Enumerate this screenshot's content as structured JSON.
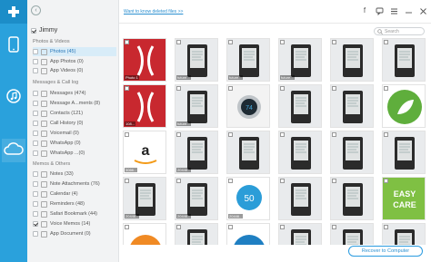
{
  "toolbar": {
    "link_text": "Want to know deleted files >>"
  },
  "search": {
    "placeholder": "Search"
  },
  "sidebar": {
    "user": "Jimmy",
    "sections": [
      {
        "title": "Photos & Videos",
        "items": [
          "Photos (45)",
          "App Photos (0)",
          "App Videos (0)"
        ]
      },
      {
        "title": "Messages & Call log",
        "items": [
          "Messages (474)",
          "Message A...ments (8)",
          "Contacts (121)",
          "Call History (0)",
          "Voicemail (0)",
          "WhatsApp (0)",
          "WhatsApp ...(0)"
        ]
      },
      {
        "title": "Memos & Others",
        "items": [
          "Notes (33)",
          "Note Attachments (76)",
          "Calendar (4)",
          "Reminders (48)",
          "Safari Bookmark (44)",
          "Voice Memos (14)",
          "App Document (0)"
        ]
      }
    ]
  },
  "grid": {
    "tiles": [
      {
        "label": "Photo 1",
        "icon": "red-tile-photo"
      },
      {
        "label": "future...",
        "icon": "ereader-photo"
      },
      {
        "label": "future...",
        "icon": "ereader-photo"
      },
      {
        "label": "future...",
        "icon": "ereader-photo"
      },
      {
        "label": "",
        "icon": "ereader-photo"
      },
      {
        "label": "",
        "icon": "ereader-photo"
      },
      {
        "label": "108...",
        "icon": "red-tile-photo"
      },
      {
        "label": "future...",
        "icon": "ereader-photo"
      },
      {
        "label": "",
        "icon": "thermostat-photo"
      },
      {
        "label": "",
        "icon": "ereader-photo"
      },
      {
        "label": "",
        "icon": "ereader-photo"
      },
      {
        "label": "",
        "icon": "green-leaf-photo"
      },
      {
        "label": "3066...",
        "icon": "amazon-logo"
      },
      {
        "label": "20446...",
        "icon": "ereader-photo"
      },
      {
        "label": "",
        "icon": "ereader-photo"
      },
      {
        "label": "",
        "icon": "ereader-photo"
      },
      {
        "label": "",
        "icon": "ereader-photo"
      },
      {
        "label": "",
        "icon": "ereader-photo"
      },
      {
        "label": "20446...",
        "icon": "ereader-photo"
      },
      {
        "label": "20446...",
        "icon": "ereader-photo"
      },
      {
        "label": "20446...",
        "icon": "blue-50-photo"
      },
      {
        "label": "",
        "icon": "ereader-photo"
      },
      {
        "label": "",
        "icon": "ereader-photo"
      },
      {
        "label": "",
        "icon": "easy-care-photo"
      },
      {
        "label": "",
        "icon": "orange-photo"
      },
      {
        "label": "",
        "icon": "ereader-photo"
      },
      {
        "label": "",
        "icon": "water-photo"
      },
      {
        "label": "",
        "icon": "ereader-photo"
      },
      {
        "label": "",
        "icon": "ereader-photo"
      },
      {
        "label": "",
        "icon": "ereader-photo"
      }
    ]
  },
  "footer": {
    "recover_label": "Recover to Computer"
  },
  "colors": {
    "accent": "#2aa1dc",
    "sidebar_bg": "#f2f3f4",
    "selected": "#d8ecf8"
  }
}
